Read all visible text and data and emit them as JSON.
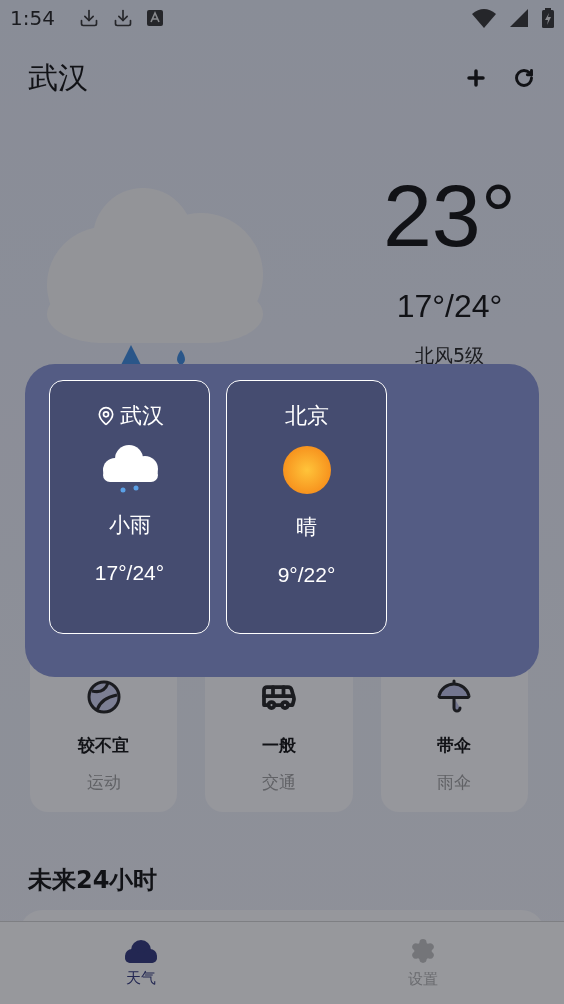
{
  "status_bar": {
    "time": "1:54"
  },
  "header": {
    "city": "武汉"
  },
  "current": {
    "kind": "rain",
    "temperature": "23°",
    "range": "17°/24°",
    "wind": "北风5级"
  },
  "indices": [
    {
      "kind": "sport",
      "value": "较不宜",
      "label": "运动"
    },
    {
      "kind": "traffic",
      "value": "一般",
      "label": "交通"
    },
    {
      "kind": "umbrella",
      "value": "带伞",
      "label": "雨伞"
    }
  ],
  "forecast": {
    "title": "未来24小时"
  },
  "tabs": [
    {
      "kind": "weather",
      "label": "天气",
      "selected": true
    },
    {
      "kind": "settings",
      "label": "设置",
      "selected": false
    }
  ],
  "city_picker": {
    "cities": [
      {
        "name": "武汉",
        "located": true,
        "kind": "rain",
        "condition": "小雨",
        "range": "17°/24°"
      },
      {
        "name": "北京",
        "located": false,
        "kind": "sunny",
        "condition": "晴",
        "range": "9°/22°"
      }
    ]
  }
}
